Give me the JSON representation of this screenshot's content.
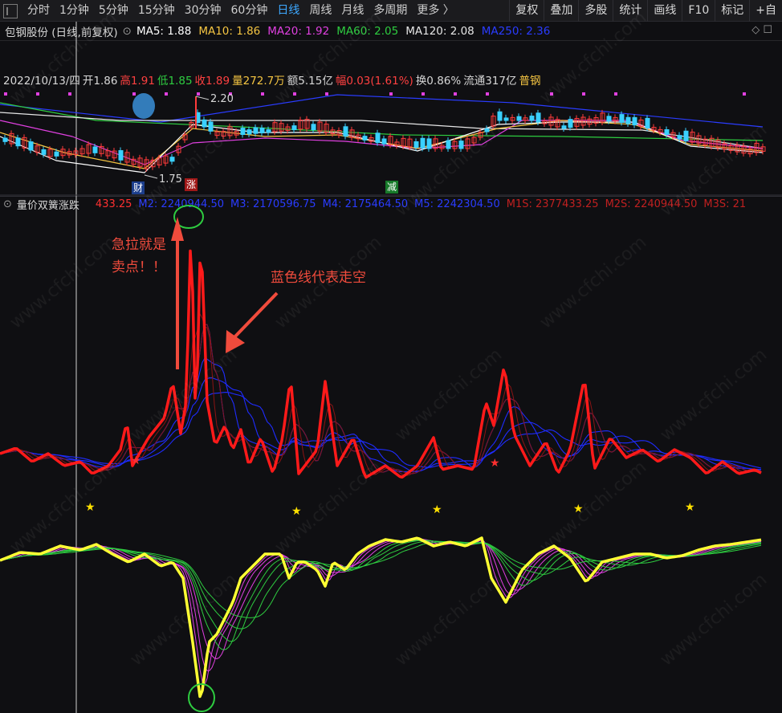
{
  "toolbar": {
    "periods": [
      "分时",
      "1分钟",
      "5分钟",
      "15分钟",
      "30分钟",
      "60分钟",
      "日线",
      "周线",
      "月线",
      "多周期",
      "更多 〉"
    ],
    "active_period": "日线",
    "right_buttons": [
      "复权",
      "叠加",
      "多股",
      "统计",
      "画线",
      "F10",
      "标记",
      "+自"
    ]
  },
  "ma_bar": {
    "stock": "包钢股份 (日线,前复权)",
    "items": [
      {
        "label": "MA5: 1.88",
        "color": "#ffffff"
      },
      {
        "label": "MA10: 1.86",
        "color": "#f5c542"
      },
      {
        "label": "MA20: 1.92",
        "color": "#e040e0"
      },
      {
        "label": "MA60: 2.05",
        "color": "#2ecc40"
      },
      {
        "label": "MA120: 2.08",
        "color": "#e6e6e6"
      },
      {
        "label": "MA250: 2.36",
        "color": "#2a3cff"
      }
    ],
    "controls": "◇  ☐"
  },
  "price_info": {
    "date": "2022/10/13/四",
    "open": "开1.86",
    "high": "高1.91",
    "low": "低1.85",
    "close": "收1.89",
    "volume": "量272.7万",
    "amount": "额5.15亿",
    "change": "幅0.03(1.61%)",
    "turnover": "换0.86%",
    "float": "流通317亿",
    "sector": "普钢"
  },
  "kline_labels": {
    "max": "2.20",
    "min": "1.75",
    "tag_cai": "财",
    "tag_zhang": "涨",
    "tag_jian": "减"
  },
  "indicator": {
    "name": "量价双簧涨跌",
    "values": [
      {
        "label": "433.25",
        "color": "#ff3030"
      },
      {
        "label": "M2: 2240944.50",
        "color": "#2a3cff"
      },
      {
        "label": "M3: 2170596.75",
        "color": "#2a3cff"
      },
      {
        "label": "M4: 2175464.50",
        "color": "#2a3cff"
      },
      {
        "label": "M5: 2242304.50",
        "color": "#2a3cff"
      },
      {
        "label": "M1S: 2377433.25",
        "color": "#c02020"
      },
      {
        "label": "M2S: 2240944.50",
        "color": "#c02020"
      },
      {
        "label": "M3S: 21",
        "color": "#c02020"
      }
    ]
  },
  "annotations": {
    "sell_line1": "急拉就是",
    "sell_line2": "卖点！！",
    "blue_note": "蓝色线代表走空"
  },
  "watermark": "www.cfchi.com",
  "colors": {
    "red": "#ff1a1a",
    "blue": "#1f2cff",
    "yellow": "#ffff33",
    "green": "#2ecc40",
    "magenta": "#e040e0"
  }
}
